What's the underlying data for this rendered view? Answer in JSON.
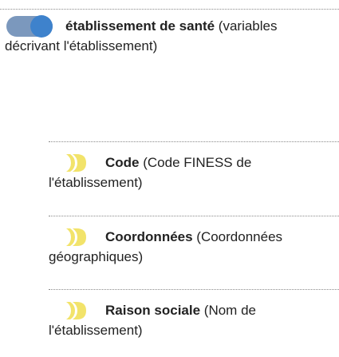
{
  "colors": {
    "toggle_track": "#7b98bd",
    "toggle_knob": "#3e82cc",
    "dim_icon": "#f2e36a"
  },
  "section": {
    "toggle_icon": "toggle-on-icon",
    "title": "établissement de santé",
    "description": " (variables",
    "description_line2": "décrivant l'établissement)"
  },
  "variables": [
    {
      "icon": "dimension-icon",
      "name": "Code",
      "desc": " (Code FINESS de",
      "desc_line2": "l'établissement)"
    },
    {
      "icon": "dimension-icon",
      "name": "Coordonnées",
      "desc": " (Coordonnées",
      "desc_line2": "géographiques)"
    },
    {
      "icon": "dimension-icon",
      "name": "Raison sociale",
      "desc": " (Nom de",
      "desc_line2": "l'établissement)"
    }
  ]
}
